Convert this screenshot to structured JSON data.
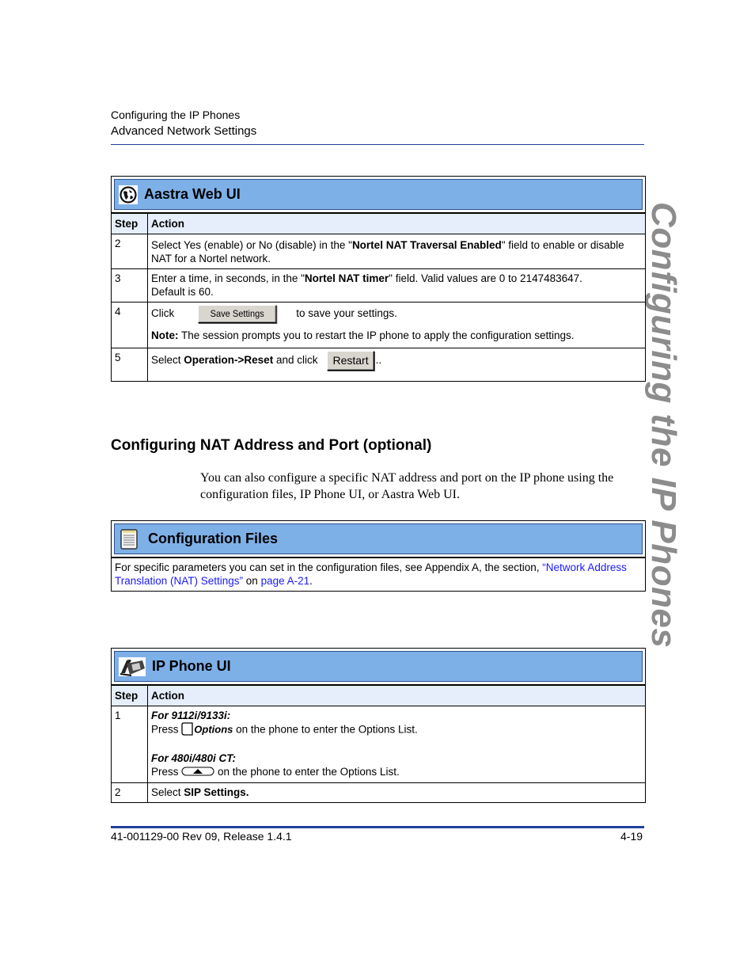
{
  "header": {
    "chapter": "Configuring the IP Phones",
    "section": "Advanced Network Settings"
  },
  "side_tab": "Configuring the IP Phones",
  "colors": {
    "panel_header": "#7eb0e8",
    "table_header": "#e5eefa",
    "rule": "#1f3f9a",
    "link": "#1a1aff",
    "side_tab": "#8c8c8c"
  },
  "web_ui_panel": {
    "icon": "globe-icon",
    "title": "Aastra Web UI",
    "columns": [
      "Step",
      "Action"
    ],
    "rows": [
      {
        "step": "2",
        "pre": "Select Yes (enable) or No (disable) in the \"",
        "bold": "Nortel NAT Traversal Enabled",
        "post": "\" field to enable or disable NAT for a Nortel network."
      },
      {
        "step": "3",
        "pre": "Enter a time, in seconds, in the \"",
        "bold": "Nortel NAT timer",
        "post": "\" field. Valid values are 0 to 2147483647.",
        "line2": "Default is 60."
      },
      {
        "step": "4",
        "pre": "Click",
        "button": "Save Settings",
        "post": "to save your settings.",
        "note_label": "Note:",
        "note_text": " The session prompts you to restart the IP phone to apply the configuration settings."
      },
      {
        "step": "5",
        "pre": "Select ",
        "bold": "Operation->Reset",
        "post": " and click",
        "button": "Restart",
        "trail": ".."
      }
    ]
  },
  "section": {
    "title": "Configuring NAT Address and Port (optional)",
    "paragraph": "You can also configure a specific NAT address and port on the IP phone using the configuration files, IP Phone UI, or Aastra Web UI."
  },
  "config_files_panel": {
    "icon": "notepad-icon",
    "title": "Configuration Files",
    "text_pre": "For specific parameters you can set in the configuration files, see Appendix A, the section, ",
    "link1": "“Network Address Translation (NAT) Settings”",
    "text_mid": " on ",
    "link2": "page A-21",
    "text_post": "."
  },
  "ip_phone_panel": {
    "icon": "desk-phone-icon",
    "title": "IP Phone UI",
    "columns": [
      "Step",
      "Action"
    ],
    "rows": [
      {
        "step": "1",
        "model1": "For 9112i/9133i:",
        "press": "Press",
        "key1": "Options",
        "post1": " on the phone to enter the Options List.",
        "model2": "For 480i/480i CT:",
        "post2": " on the phone to enter the Options List."
      },
      {
        "step": "2",
        "pre": "Select ",
        "bold": "SIP Settings."
      }
    ]
  },
  "footer": {
    "doc_id": "41-001129-00 Rev 09, Release 1.4.1",
    "page": "4-19"
  }
}
